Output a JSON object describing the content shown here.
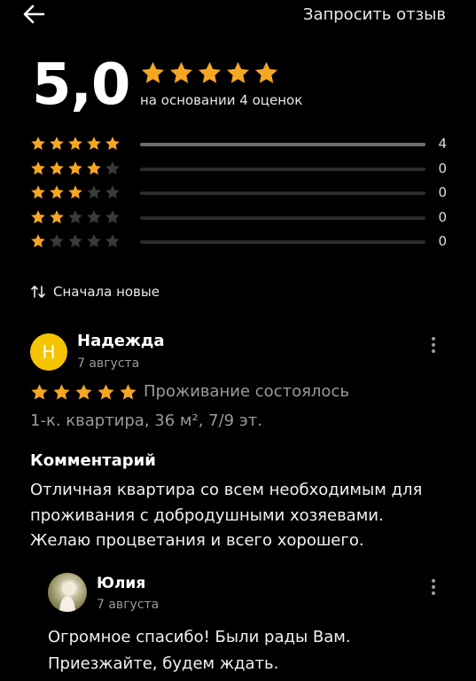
{
  "header": {
    "request_review_label": "Запросить отзыв",
    "back_icon": "arrow-left-icon"
  },
  "summary": {
    "rating": "5,0",
    "stars": 5,
    "based_on": "на основании 4 оценок"
  },
  "distribution": [
    {
      "stars": 5,
      "count": "4",
      "share": 1.0
    },
    {
      "stars": 4,
      "count": "0",
      "share": 0
    },
    {
      "stars": 3,
      "count": "0",
      "share": 0
    },
    {
      "stars": 2,
      "count": "0",
      "share": 0
    },
    {
      "stars": 1,
      "count": "0",
      "share": 0
    }
  ],
  "sort": {
    "label": "Сначала новые",
    "icon": "sort-arrows-icon"
  },
  "review": {
    "avatar_letter": "Н",
    "author": "Надежда",
    "date": "7 августа",
    "stars": 5,
    "status": "Проживание состоялось",
    "apartment": "1-к. квартира, 36 м², 7/9 эт.",
    "comment_title": "Комментарий",
    "comment_text": "Отличная квартира со всем необходимым для проживания с добродушными хозяевами. Желаю процветания и всего хорошего.",
    "reply": {
      "author": "Юлия",
      "date": "7 августа",
      "text": "Огромное спасибо! Были рады Вам. Приезжайте, будем ждать."
    }
  },
  "colors": {
    "star_active": "#f5a623",
    "star_inactive": "#3a3a3a",
    "avatar": "#f5c400",
    "background": "#000000"
  }
}
